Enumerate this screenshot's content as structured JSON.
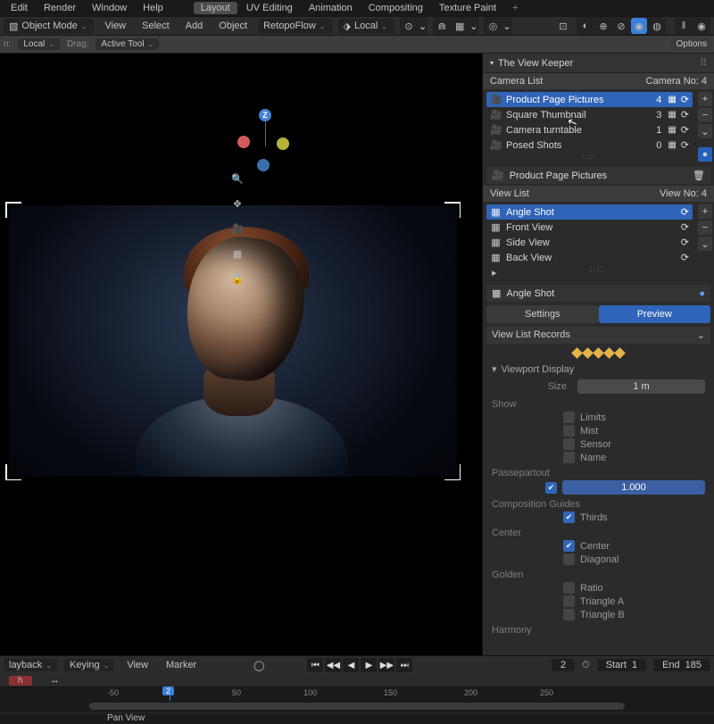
{
  "top_menu": {
    "edit": "Edit",
    "render": "Render",
    "window": "Window",
    "help": "Help",
    "layout": "Layout",
    "uv": "UV Editing",
    "anim": "Animation",
    "comp": "Compositing",
    "tex": "Texture Paint"
  },
  "bar2": {
    "mode": "Object Mode",
    "view": "View",
    "select": "Select",
    "add": "Add",
    "object": "Object",
    "retopo": "RetopoFlow",
    "orient": "Local"
  },
  "bar3": {
    "orient_lbl": "n:",
    "orient": "Local",
    "drag_lbl": "Drag:",
    "drag": "Active Tool"
  },
  "sidebar": {
    "options": "Options",
    "panel_title": "The View Keeper",
    "camera_list_hdr": "Camera List",
    "camera_no_lbl": "Camera No:",
    "camera_no": "4",
    "cameras": [
      {
        "name": "Product Page Pictures",
        "count": "4"
      },
      {
        "name": "Square Thumbnail",
        "count": "3"
      },
      {
        "name": "Camera turntable",
        "count": "1"
      },
      {
        "name": "Posed Shots",
        "count": "0"
      }
    ],
    "active_camera": "Product Page Pictures",
    "view_list_hdr": "View List",
    "view_no_lbl": "View No:",
    "view_no": "4",
    "views": [
      {
        "name": "Angle Shot"
      },
      {
        "name": "Front View"
      },
      {
        "name": "Side View"
      },
      {
        "name": "Back View"
      }
    ],
    "active_view": "Angle Shot",
    "tab_settings": "Settings",
    "tab_preview": "Preview",
    "records": "View List Records",
    "vp_display": "Viewport Display",
    "size_lbl": "Size",
    "size_val": "1 m",
    "show": "Show",
    "show_items": {
      "limits": "Limits",
      "mist": "Mist",
      "sensor": "Sensor",
      "name": "Name"
    },
    "passe": "Passepartout",
    "passe_val": "1.000",
    "comp_guides": "Composition Guides",
    "thirds": "Thirds",
    "center_hdr": "Center",
    "center": "Center",
    "diag": "Diagonal",
    "golden": "Golden",
    "ratio": "Ratio",
    "triA": "Triangle A",
    "triB": "Triangle B",
    "harmony": "Harmony"
  },
  "timeline": {
    "playback": "layback",
    "keying": "Keying",
    "view": "View",
    "marker": "Marker",
    "frame": "2",
    "start_lbl": "Start",
    "start": "1",
    "end_lbl": "End",
    "end": "185",
    "ticks": {
      "m50": "-50",
      "p2": "2",
      "p50": "50",
      "p100": "100",
      "p150": "150",
      "p200": "200",
      "p250": "250"
    },
    "panview": "Pan View"
  },
  "gizmo": {
    "z": "Z"
  }
}
